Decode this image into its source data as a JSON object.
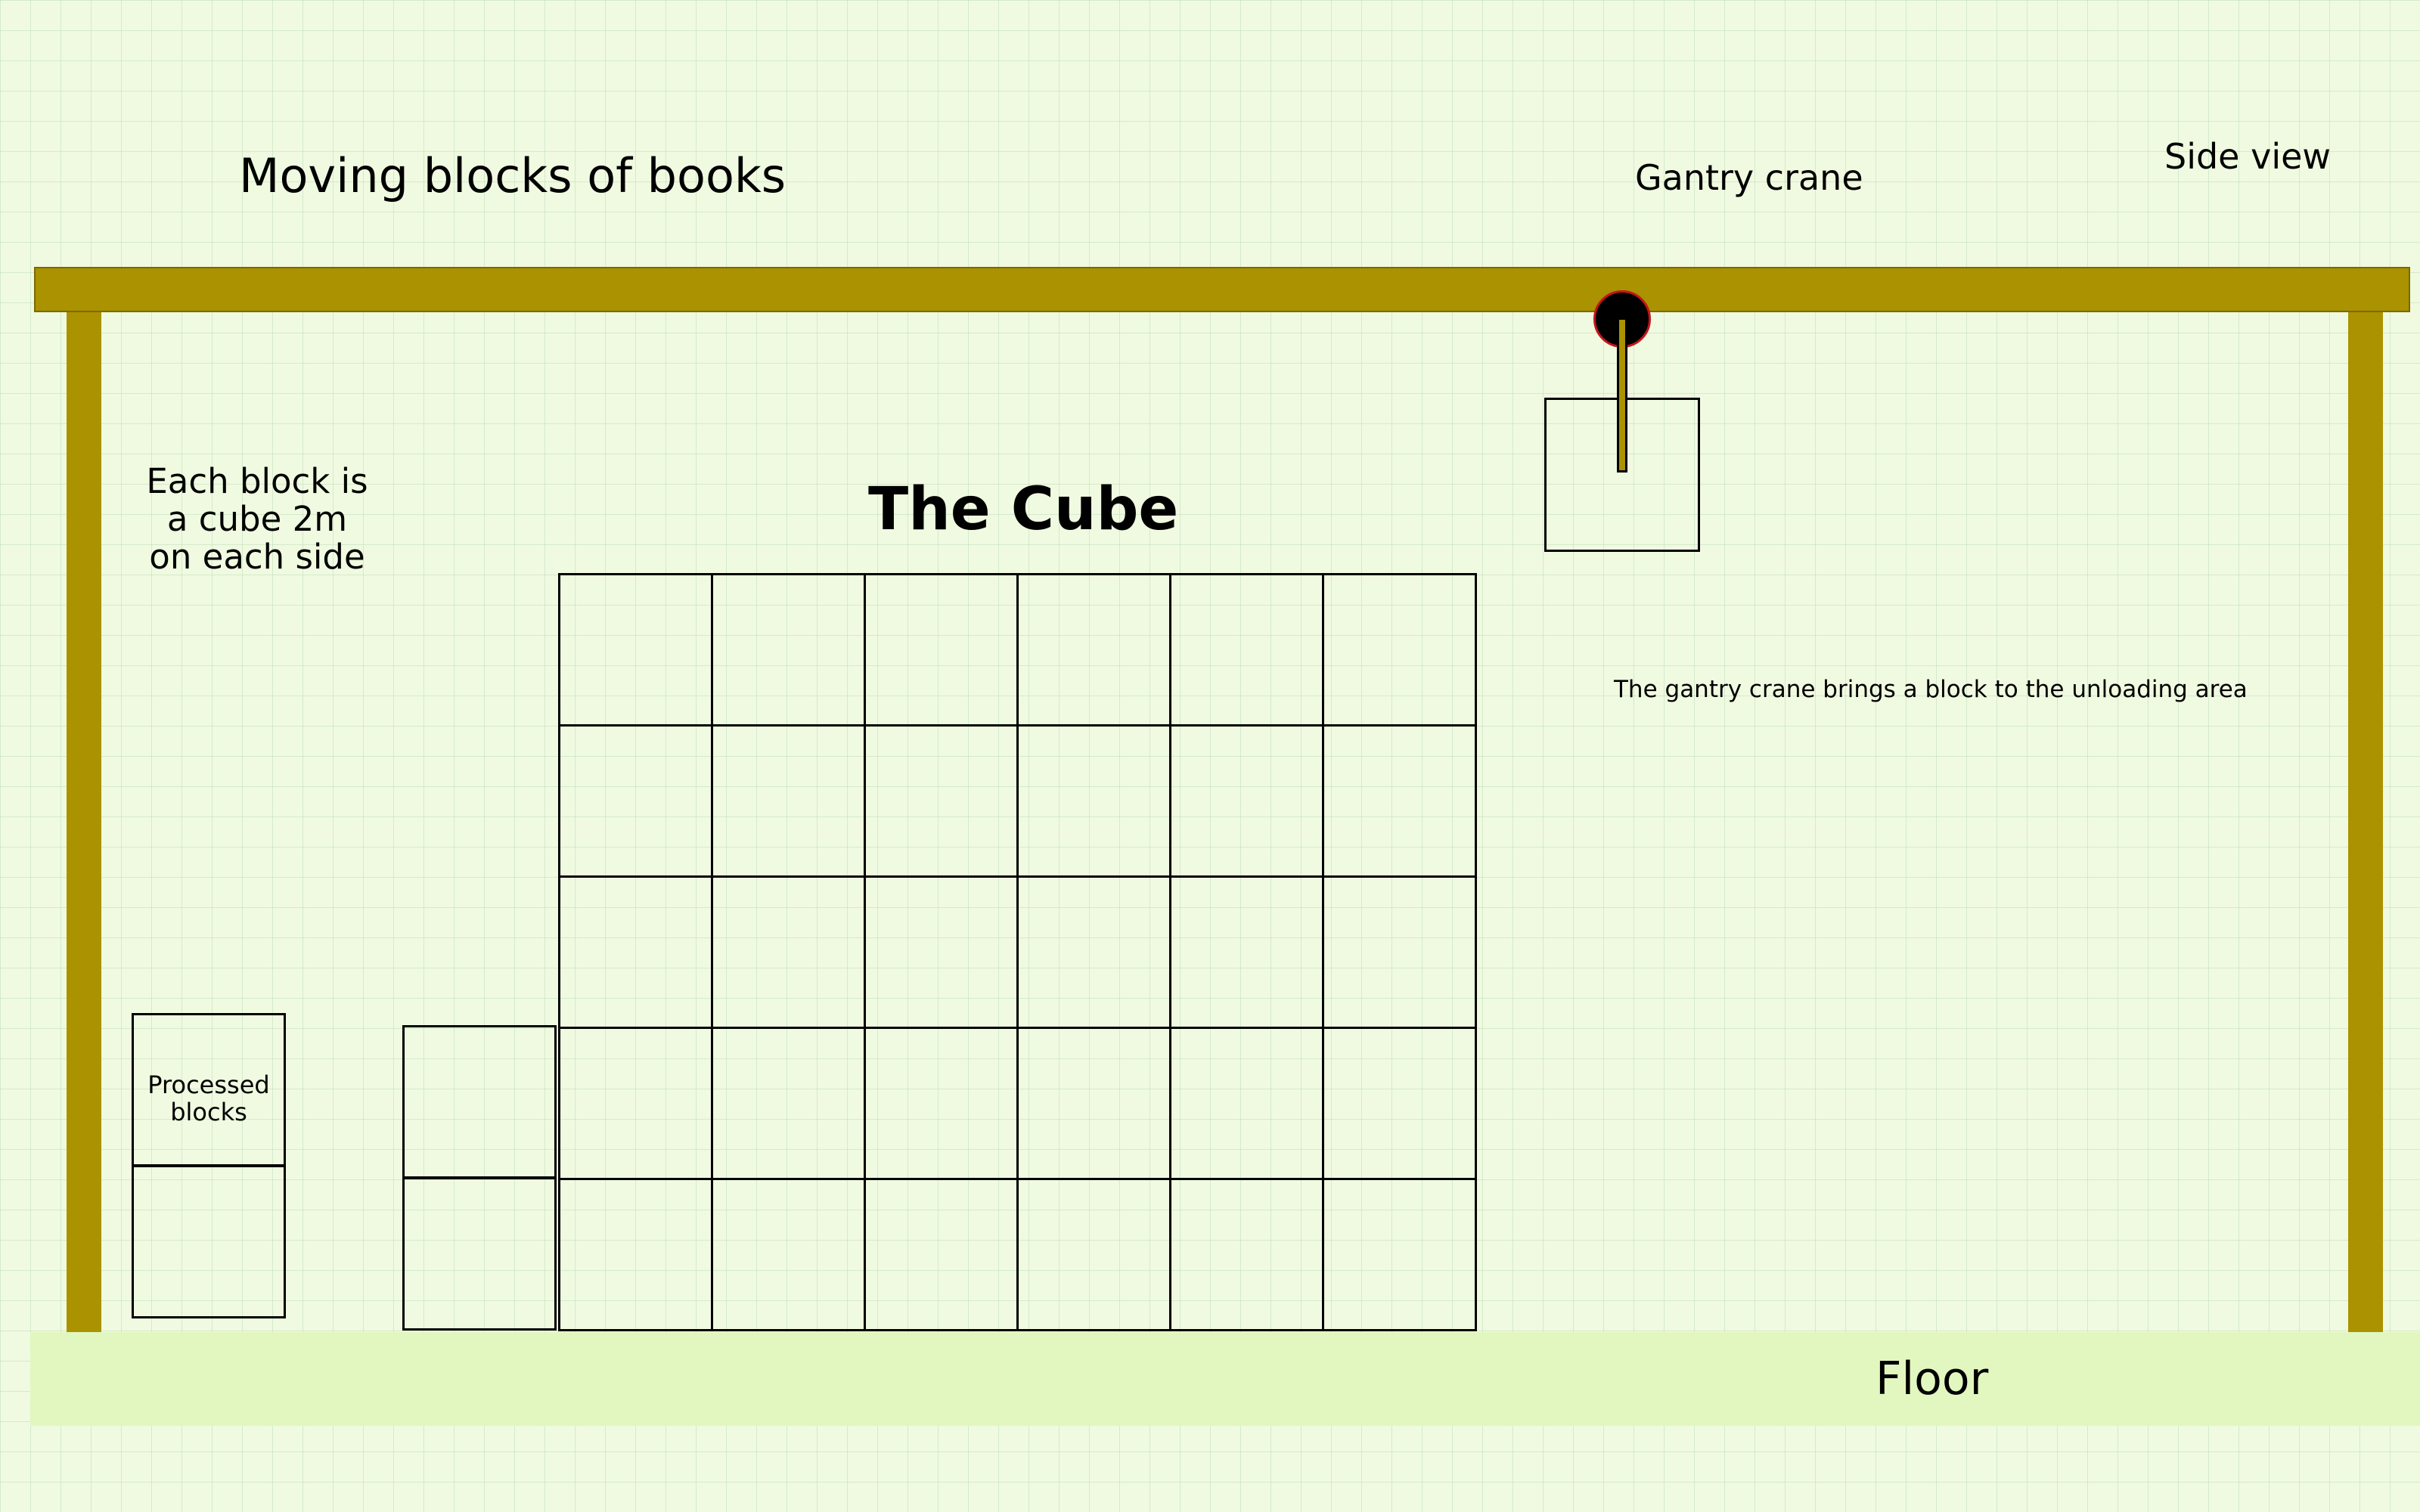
{
  "title": "Moving blocks of books",
  "view_label": "Side view",
  "crane_label": "Gantry crane",
  "cube_label": "The Cube",
  "block_note": {
    "line1": "Each block is",
    "line2": "a cube 2m",
    "line3": "on each side"
  },
  "crane_note": "The gantry crane brings a block to the unloading area",
  "processed_label": {
    "line1": "Processed",
    "line2": "blocks"
  },
  "floor_label": "Floor",
  "cube_grid": {
    "columns": 6,
    "rows": 5
  },
  "processed_stack_blocks": 2,
  "waiting_stack_blocks": 2,
  "colors": {
    "gantry": "#aa9200",
    "floor": "#e2f7bf",
    "background": "#f0fae0",
    "pulley": "#000000",
    "pulley_outline": "#c4151c"
  }
}
